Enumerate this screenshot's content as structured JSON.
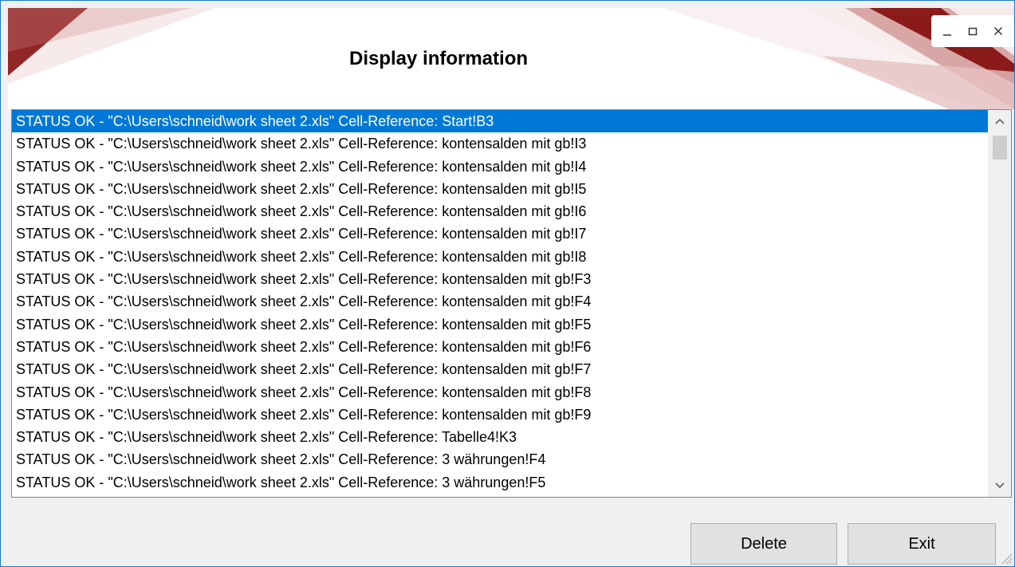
{
  "window": {
    "title": "Display information",
    "controls": {
      "minimize_icon": "minimize-icon",
      "maximize_icon": "maximize-icon",
      "close_icon": "close-icon"
    }
  },
  "colors": {
    "accent_dark_red": "#8b1a1a",
    "accent_light_red": "#d9a6a6",
    "selection_blue": "#0078d7",
    "window_border": "#1979ca"
  },
  "list": {
    "selected_index": 0,
    "items": [
      "STATUS OK - \"C:\\Users\\schneid\\work sheet 2.xls\" Cell-Reference: Start!B3",
      "STATUS OK - \"C:\\Users\\schneid\\work sheet 2.xls\" Cell-Reference: kontensalden mit gb!I3",
      "STATUS OK - \"C:\\Users\\schneid\\work sheet 2.xls\" Cell-Reference: kontensalden mit gb!I4",
      "STATUS OK - \"C:\\Users\\schneid\\work sheet 2.xls\" Cell-Reference: kontensalden mit gb!I5",
      "STATUS OK - \"C:\\Users\\schneid\\work sheet 2.xls\" Cell-Reference: kontensalden mit gb!I6",
      "STATUS OK - \"C:\\Users\\schneid\\work sheet 2.xls\" Cell-Reference: kontensalden mit gb!I7",
      "STATUS OK - \"C:\\Users\\schneid\\work sheet 2.xls\" Cell-Reference: kontensalden mit gb!I8",
      "STATUS OK - \"C:\\Users\\schneid\\work sheet 2.xls\" Cell-Reference: kontensalden mit gb!F3",
      "STATUS OK - \"C:\\Users\\schneid\\work sheet 2.xls\" Cell-Reference: kontensalden mit gb!F4",
      "STATUS OK - \"C:\\Users\\schneid\\work sheet 2.xls\" Cell-Reference: kontensalden mit gb!F5",
      "STATUS OK - \"C:\\Users\\schneid\\work sheet 2.xls\" Cell-Reference: kontensalden mit gb!F6",
      "STATUS OK - \"C:\\Users\\schneid\\work sheet 2.xls\" Cell-Reference: kontensalden mit gb!F7",
      "STATUS OK - \"C:\\Users\\schneid\\work sheet 2.xls\" Cell-Reference: kontensalden mit gb!F8",
      "STATUS OK - \"C:\\Users\\schneid\\work sheet 2.xls\" Cell-Reference: kontensalden mit gb!F9",
      "STATUS OK - \"C:\\Users\\schneid\\work sheet 2.xls\" Cell-Reference: Tabelle4!K3",
      "STATUS OK - \"C:\\Users\\schneid\\work sheet 2.xls\" Cell-Reference: 3 währungen!F4",
      "STATUS OK - \"C:\\Users\\schneid\\work sheet 2.xls\" Cell-Reference: 3 währungen!F5"
    ]
  },
  "scrollbar": {
    "up_icon": "scroll-up-arrow-icon",
    "down_icon": "scroll-down-arrow-icon"
  },
  "buttons": {
    "delete_label": "Delete",
    "exit_label": "Exit"
  }
}
